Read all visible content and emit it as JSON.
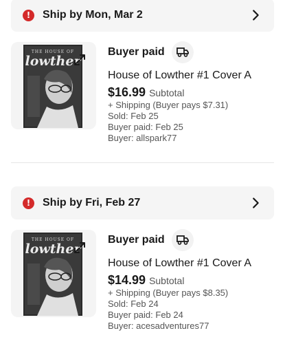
{
  "orders": [
    {
      "ship_by": "Ship by Mon, Mar 2",
      "status_label": "Buyer paid",
      "title": "House of Lowther #1 Cover A",
      "price": "$16.99",
      "subtotal_label": "Subtotal",
      "shipping": "+ Shipping (Buyer pays $7.31)",
      "sold": "Sold: Feb 25",
      "buyer_paid": "Buyer paid: Feb 25",
      "buyer": "Buyer: allspark77",
      "cover_text": "THE HOUSE OF lowther"
    },
    {
      "ship_by": "Ship by Fri, Feb 27",
      "status_label": "Buyer paid",
      "title": "House of Lowther #1 Cover A",
      "price": "$14.99",
      "subtotal_label": "Subtotal",
      "shipping": "+ Shipping (Buyer pays $8.35)",
      "sold": "Sold: Feb 24",
      "buyer_paid": "Buyer paid: Feb 24",
      "buyer": "Buyer: acesadventures77",
      "cover_text": "THE HOUSE OF lowther"
    }
  ],
  "icons": {
    "alert": "alert-icon",
    "chevron": "chevron-right-icon",
    "truck": "truck-icon",
    "expand": "expand-icon"
  },
  "colors": {
    "alert": "#d42a2a",
    "bar_bg": "#f5f5f5",
    "text": "#191919",
    "muted": "#555555"
  }
}
